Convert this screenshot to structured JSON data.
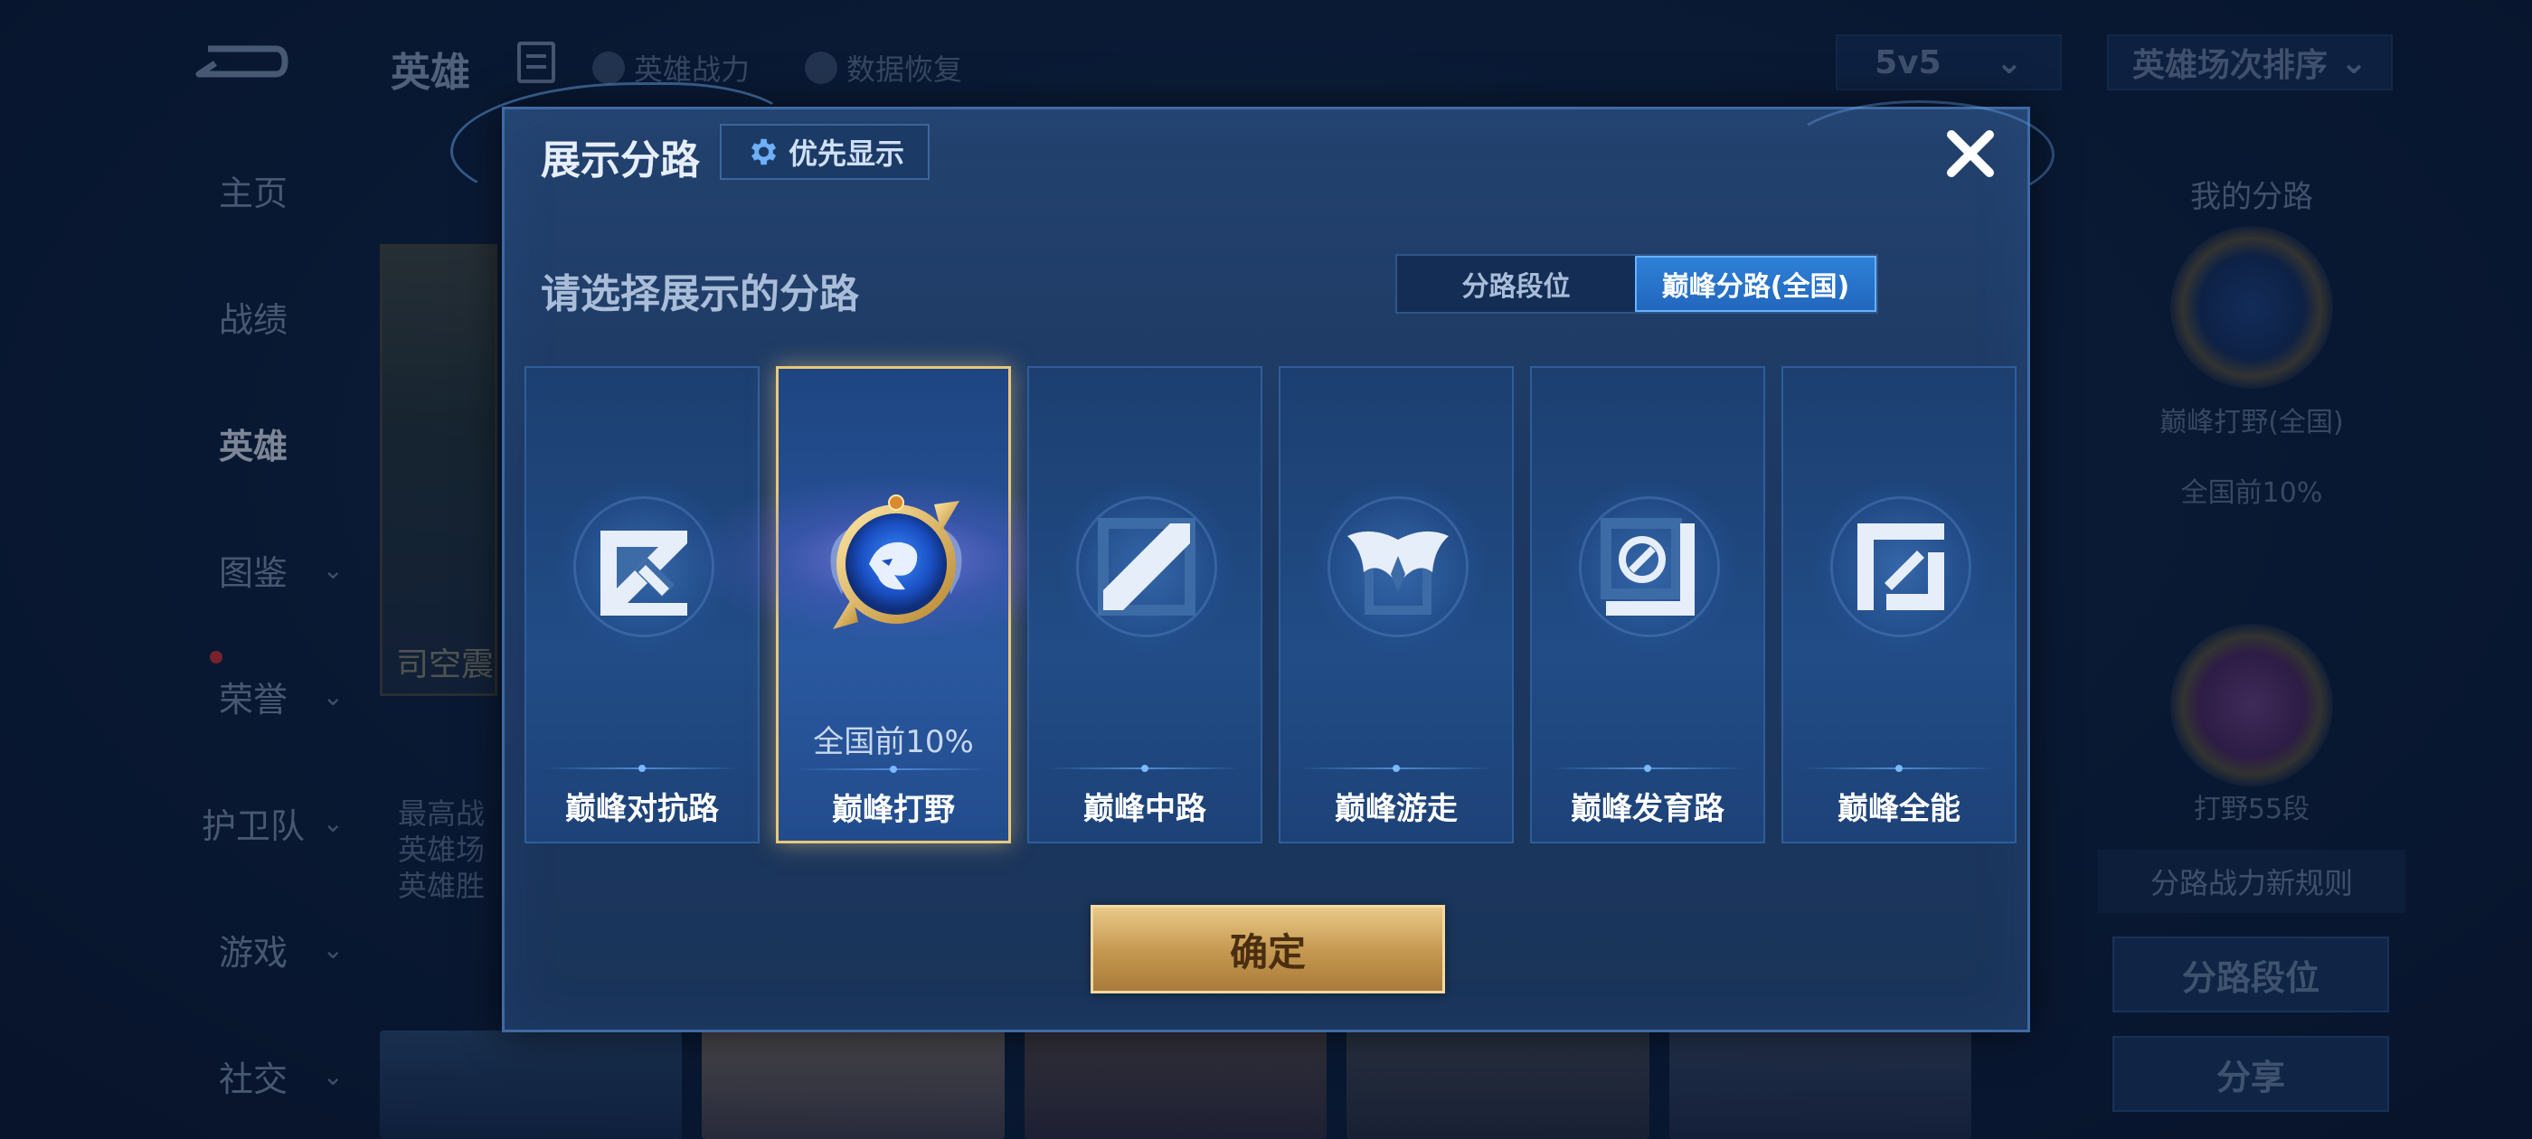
{
  "background": {
    "nav_title": "英雄",
    "links": [
      "英雄战力",
      "数据恢复"
    ],
    "sidebar": [
      {
        "label": "主页",
        "has_chevron": false
      },
      {
        "label": "战绩",
        "has_chevron": false
      },
      {
        "label": "英雄",
        "has_chevron": false
      },
      {
        "label": "图鉴",
        "has_chevron": true
      },
      {
        "label": "荣誉",
        "has_chevron": true
      },
      {
        "label": "护卫队",
        "has_chevron": true
      },
      {
        "label": "游戏",
        "has_chevron": true
      },
      {
        "label": "社交",
        "has_chevron": true
      }
    ],
    "mode_select": "5v5",
    "sort_select": "英雄场次排序",
    "hero_name": "司空震",
    "hero_stats": [
      "最高战",
      "英雄场",
      "英雄胜"
    ],
    "right_panel": {
      "title": "我的分路",
      "badge1_label": "巅峰打野(全国)",
      "badge1_rank": "全国前10%",
      "badge2_label": "打野55段",
      "new_rule": "分路战力新规则",
      "btn_lane_rank": "分路段位",
      "btn_share": "分享"
    }
  },
  "modal": {
    "title": "展示分路",
    "priority_button": "优先显示",
    "subtitle": "请选择展示的分路",
    "toggle": [
      {
        "label": "分路段位",
        "active": false
      },
      {
        "label": "巅峰分路(全国)",
        "active": true
      }
    ],
    "lanes": [
      {
        "name": "巅峰对抗路",
        "icon": "clash-lane-icon",
        "selected": false,
        "rank": ""
      },
      {
        "name": "巅峰打野",
        "icon": "jungle-badge-icon",
        "selected": true,
        "rank": "全国前10%"
      },
      {
        "name": "巅峰中路",
        "icon": "mid-lane-icon",
        "selected": false,
        "rank": ""
      },
      {
        "name": "巅峰游走",
        "icon": "roam-icon",
        "selected": false,
        "rank": ""
      },
      {
        "name": "巅峰发育路",
        "icon": "farm-lane-icon",
        "selected": false,
        "rank": ""
      },
      {
        "name": "巅峰全能",
        "icon": "all-round-icon",
        "selected": false,
        "rank": ""
      }
    ],
    "confirm_button": "确定"
  },
  "colors": {
    "modal_bg": "#1d3963",
    "toggle_active": "#2f80d8",
    "selected_border": "#e8c77a",
    "confirm_gold": "#c79a52"
  }
}
